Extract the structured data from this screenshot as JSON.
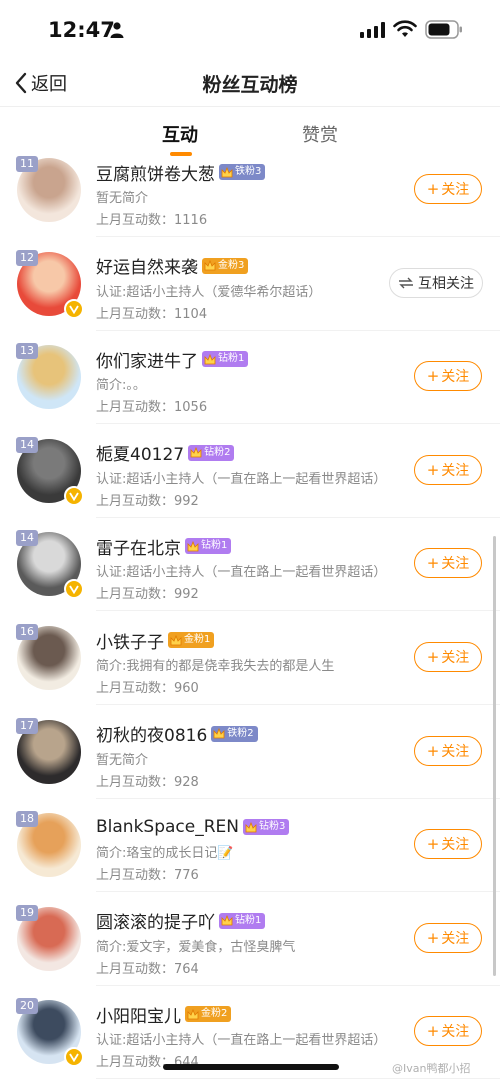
{
  "status_bar": {
    "time": "12:47"
  },
  "nav": {
    "back_label": "返回",
    "title": "粉丝互动榜"
  },
  "tabs": [
    {
      "label": "互动"
    },
    {
      "label": "赞赏"
    }
  ],
  "labels": {
    "follow": "关注",
    "mutual": "互相关注",
    "count_prefix": "上月互动数："
  },
  "colors": {
    "accent": "#ff8a00",
    "rank_badge": "#9aa0c8",
    "iron_badge": "#7d89c8",
    "gold_badge": "#f0a020",
    "diamond_badge": "#b07cf0",
    "verified": "#f5b300"
  },
  "rows": [
    {
      "rank": "11",
      "name": "豆腐煎饼卷大葱",
      "badge": "铁粉3",
      "badge_kind": "iron",
      "desc": "暂无简介",
      "count": "1116",
      "button": "follow",
      "verified": false
    },
    {
      "rank": "12",
      "name": "好运自然来袭",
      "badge": "金粉3",
      "badge_kind": "gold",
      "desc": "认证:超话小主持人（爱德华希尔超话）",
      "count": "1104",
      "button": "mutual",
      "verified": true
    },
    {
      "rank": "13",
      "name": "你们家进牛了",
      "badge": "钻粉1",
      "badge_kind": "diamond",
      "desc": "简介:。。",
      "count": "1056",
      "button": "follow",
      "verified": false
    },
    {
      "rank": "14",
      "name": "栀夏40127",
      "badge": "钻粉2",
      "badge_kind": "diamond",
      "desc": "认证:超话小主持人（一直在路上一起看世界超话）",
      "count": "992",
      "button": "follow",
      "verified": true
    },
    {
      "rank": "14",
      "name": "雷子在北京",
      "badge": "钻粉1",
      "badge_kind": "diamond",
      "desc": "认证:超话小主持人（一直在路上一起看世界超话）",
      "count": "992",
      "button": "follow",
      "verified": true
    },
    {
      "rank": "16",
      "name": "小铁子子",
      "badge": "金粉1",
      "badge_kind": "gold",
      "desc": "简介:我拥有的都是侥幸我失去的都是人生",
      "count": "960",
      "button": "follow",
      "verified": false
    },
    {
      "rank": "17",
      "name": "初秋的夜0816",
      "badge": "铁粉2",
      "badge_kind": "iron",
      "desc": "暂无简介",
      "count": "928",
      "button": "follow",
      "verified": false
    },
    {
      "rank": "18",
      "name": "BlankSpace_REN",
      "badge": "钻粉3",
      "badge_kind": "diamond",
      "desc": "简介:珞宝的成长日记📝",
      "count": "776",
      "button": "follow",
      "verified": false
    },
    {
      "rank": "19",
      "name": "圆滚滚的提子吖",
      "badge": "钻粉1",
      "badge_kind": "diamond",
      "desc": "简介:爱文字，爱美食，古怪臭脾气",
      "count": "764",
      "button": "follow",
      "verified": false
    },
    {
      "rank": "20",
      "name": "小阳阳宝儿",
      "badge": "金粉2",
      "badge_kind": "gold",
      "desc": "认证:超话小主持人（一直在路上一起看世界超话）",
      "count": "644",
      "button": "follow",
      "verified": true
    }
  ],
  "watermark": "@Ivan鸭都小招"
}
